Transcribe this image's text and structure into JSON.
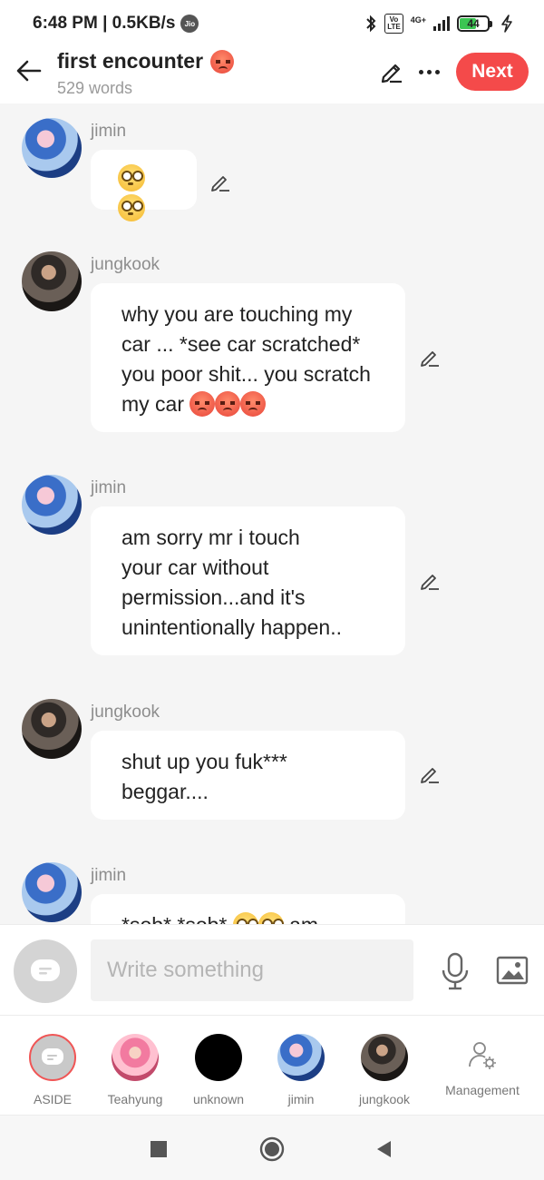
{
  "status_bar": {
    "time_speed": "6:48 PM | 0.5KB/s",
    "carrier_badge": "Jio",
    "volte": "Vo\nLTE",
    "network": "4G+",
    "battery_level": "44",
    "icons": [
      "bluetooth-icon",
      "volte-icon",
      "signal-icon",
      "battery-icon",
      "charging-icon"
    ]
  },
  "header": {
    "title": "first encounter",
    "title_emoji": "angry-face",
    "word_count": "529 words",
    "next_label": "Next",
    "colors": {
      "accent": "#f44a4a"
    }
  },
  "messages": [
    {
      "speaker": "jimin",
      "text": "",
      "emojis": [
        "flushed-face",
        "flushed-face"
      ]
    },
    {
      "speaker": "jungkook",
      "text": "why you are touching my\ncar ...  *see car scratched*\nyou poor shit... you scratch\nmy car",
      "emojis": [
        "angry-face",
        "angry-face",
        "angry-face"
      ]
    },
    {
      "speaker": "jimin",
      "text": "am sorry mr  i touch\nyour car without\npermission...and it's\nunintentionally happen..",
      "emojis": []
    },
    {
      "speaker": "jungkook",
      "text": "shut up you fuk***\nbeggar....",
      "emojis": []
    },
    {
      "speaker": "jimin",
      "text": "*sob* *sob*",
      "emojis": [
        "flushed-face",
        "flushed-face"
      ],
      "trailing_text": "am"
    }
  ],
  "input": {
    "placeholder": "Write something"
  },
  "characters": [
    {
      "label": "ASIDE"
    },
    {
      "label": "Teahyung"
    },
    {
      "label": "unknown"
    },
    {
      "label": "jimin"
    },
    {
      "label": "jungkook"
    },
    {
      "label": "Management"
    }
  ]
}
